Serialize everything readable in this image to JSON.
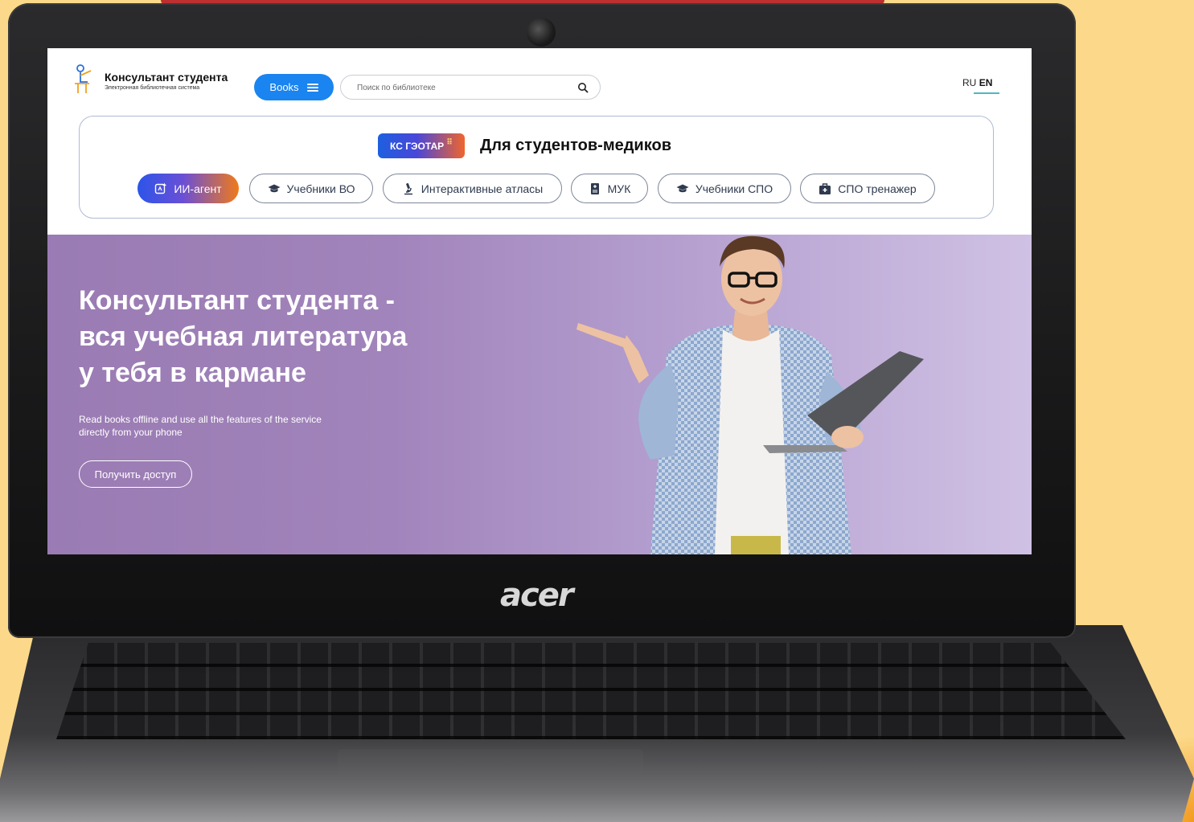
{
  "header": {
    "logo_title": "Консультант студента",
    "logo_subtitle": "Электронная библиотечная система",
    "books_button": "Books",
    "search_placeholder": "Поиск по библиотеке",
    "lang_ru": "RU",
    "lang_en": "EN"
  },
  "nav_card": {
    "badge": "КС ГЭОТАР",
    "title": "Для студентов-медиков",
    "chips": [
      {
        "label": "ИИ-агент",
        "icon": "sparkle-icon"
      },
      {
        "label": "Учебники ВО",
        "icon": "graduation-cap-icon"
      },
      {
        "label": "Интерактивные атласы",
        "icon": "microscope-icon"
      },
      {
        "label": "МУК",
        "icon": "book-icon"
      },
      {
        "label": "Учебники СПО",
        "icon": "graduation-cap-icon"
      },
      {
        "label": "СПО тренажер",
        "icon": "medkit-icon"
      }
    ]
  },
  "hero": {
    "title_line1": "Консультант студента -",
    "title_line2": "вся учебная литература",
    "title_line3": "у тебя в кармане",
    "subtitle": "Read books offline and use all the features of the service directly from your phone",
    "cta": "Получить доступ"
  },
  "device": {
    "brand": "acer"
  },
  "colors": {
    "page_background": "#fcd98a",
    "accent_blue": "#1a84f0",
    "hero_purple": "#9a7bb3"
  }
}
